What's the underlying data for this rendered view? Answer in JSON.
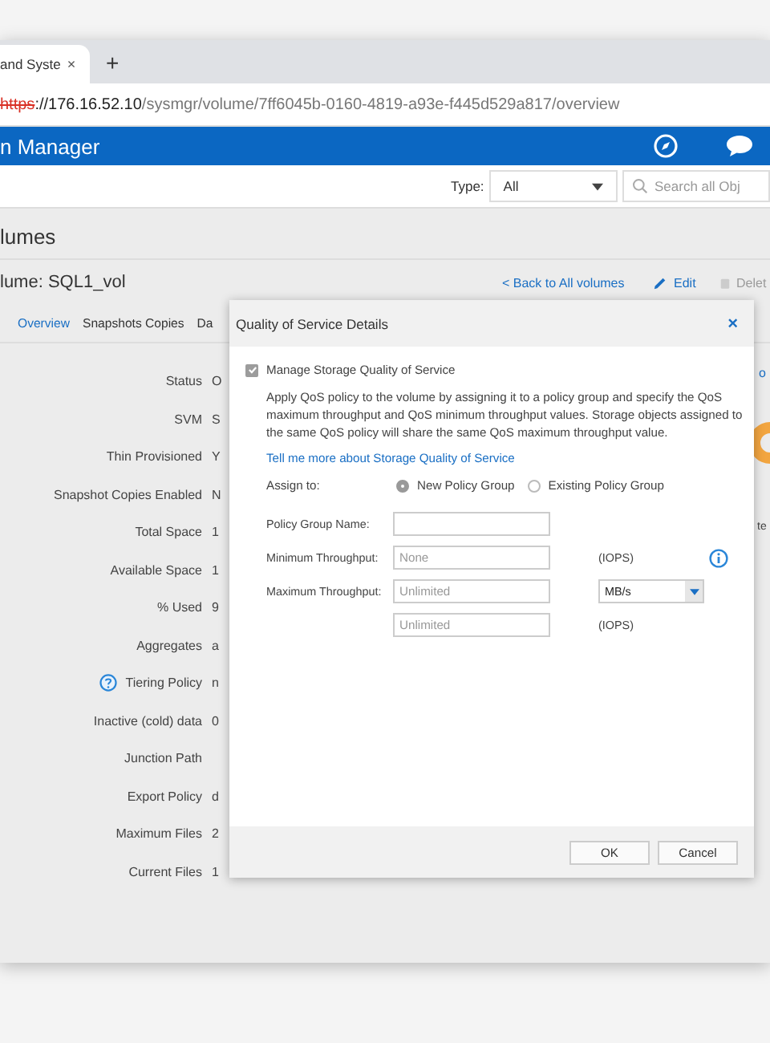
{
  "browser": {
    "tab_title": "and Syste",
    "tab_close": "×",
    "new_tab": "+",
    "url_scheme": "https",
    "url_host": "://176.16.52.10",
    "url_path": "/sysmgr/volume/7ff6045b-0160-4819-a93e-f445d529a817/overview"
  },
  "app": {
    "title": "n Manager"
  },
  "toolbar": {
    "type_label": "Type:",
    "type_value": "All",
    "search_placeholder": "Search all Obj"
  },
  "page": {
    "heading": "lumes",
    "volume_title": "lume: SQL1_vol",
    "back_link": "< Back to All volumes",
    "edit": "Edit",
    "delete": {
      "label": "Delet",
      "disabled": true
    }
  },
  "tabs": [
    {
      "label": "Overview",
      "selected": true
    },
    {
      "label": "Snapshots Copies",
      "selected": false
    },
    {
      "label": "Da",
      "selected": false
    }
  ],
  "properties": [
    {
      "label": "Status",
      "value": "O",
      "help": false
    },
    {
      "label": "SVM",
      "value": "S",
      "help": false
    },
    {
      "label": "Thin Provisioned",
      "value": "Y",
      "help": false
    },
    {
      "label": "Snapshot Copies Enabled",
      "value": "N",
      "help": false
    },
    {
      "label": "Total Space",
      "value": "1",
      "help": false
    },
    {
      "label": "Available Space",
      "value": "1",
      "help": false
    },
    {
      "label": "% Used",
      "value": "9",
      "help": false
    },
    {
      "label": "Aggregates",
      "value": "a",
      "help": false
    },
    {
      "label": "Tiering Policy",
      "value": "n",
      "help": true
    },
    {
      "label": "Inactive (cold) data",
      "value": "0",
      "help": false
    },
    {
      "label": "Junction Path",
      "help": false
    },
    {
      "label": "Export Policy",
      "value": "d",
      "help": false
    },
    {
      "label": "Maximum Files",
      "value": "2",
      "help": false
    },
    {
      "label": "Current Files",
      "value": "1",
      "help": false
    }
  ],
  "edge": {
    "link": "o",
    "text": "te"
  },
  "dialog": {
    "title": "Quality of Service Details",
    "close": "×",
    "manage": {
      "label": "Manage Storage Quality of Service",
      "checked": true,
      "disabled": true
    },
    "description": "Apply QoS policy to the volume by assigning it to a policy group and specify the QoS maximum throughput and QoS minimum throughput values. Storage objects assigned to the same QoS policy will share the same QoS maximum throughput value.",
    "link": "Tell me more about Storage Quality of Service",
    "assign_label": "Assign to:",
    "assign_options": [
      {
        "label": "New Policy Group",
        "selected": true
      },
      {
        "label": "Existing Policy Group",
        "selected": false
      }
    ],
    "fields": [
      {
        "label": "Policy Group Name:",
        "info": false
      },
      {
        "label": "Minimum Throughput:",
        "placeholder": "None",
        "unit": {
          "kind": "text",
          "text": "(IOPS)"
        },
        "info": true
      },
      {
        "label": "Maximum Throughput:",
        "placeholder": "Unlimited",
        "unit": {
          "kind": "select",
          "text": "MB/s"
        },
        "info": false
      },
      {
        "placeholder": "Unlimited",
        "unit": {
          "kind": "text",
          "text": "(IOPS)"
        },
        "info": false
      }
    ],
    "buttons": [
      "OK",
      "Cancel"
    ]
  }
}
